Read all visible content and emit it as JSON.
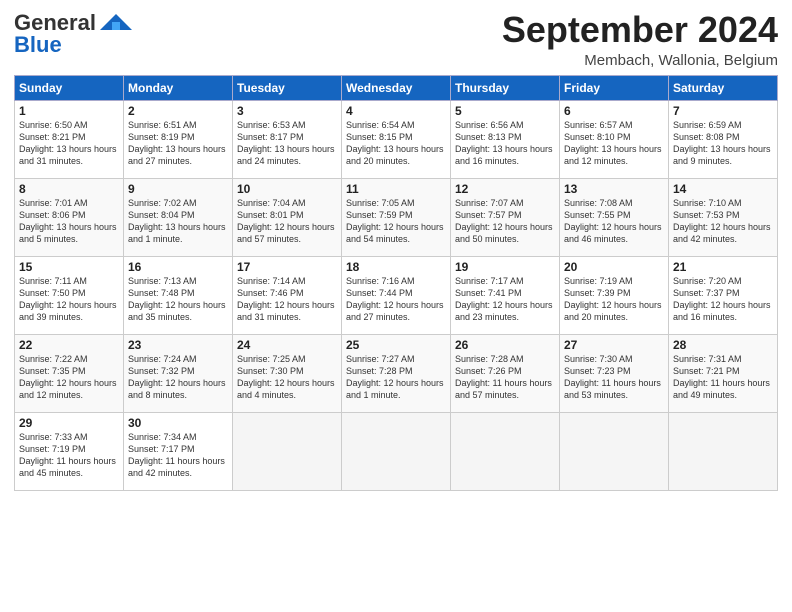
{
  "header": {
    "logo_general": "General",
    "logo_blue": "Blue",
    "month_title": "September 2024",
    "location": "Membach, Wallonia, Belgium"
  },
  "weekdays": [
    "Sunday",
    "Monday",
    "Tuesday",
    "Wednesday",
    "Thursday",
    "Friday",
    "Saturday"
  ],
  "weeks": [
    [
      {
        "day": "1",
        "sunrise": "6:50 AM",
        "sunset": "8:21 PM",
        "daylight": "13 hours and 31 minutes."
      },
      {
        "day": "2",
        "sunrise": "6:51 AM",
        "sunset": "8:19 PM",
        "daylight": "13 hours and 27 minutes."
      },
      {
        "day": "3",
        "sunrise": "6:53 AM",
        "sunset": "8:17 PM",
        "daylight": "13 hours and 24 minutes."
      },
      {
        "day": "4",
        "sunrise": "6:54 AM",
        "sunset": "8:15 PM",
        "daylight": "13 hours and 20 minutes."
      },
      {
        "day": "5",
        "sunrise": "6:56 AM",
        "sunset": "8:13 PM",
        "daylight": "13 hours and 16 minutes."
      },
      {
        "day": "6",
        "sunrise": "6:57 AM",
        "sunset": "8:10 PM",
        "daylight": "13 hours and 12 minutes."
      },
      {
        "day": "7",
        "sunrise": "6:59 AM",
        "sunset": "8:08 PM",
        "daylight": "13 hours and 9 minutes."
      }
    ],
    [
      {
        "day": "8",
        "sunrise": "7:01 AM",
        "sunset": "8:06 PM",
        "daylight": "13 hours and 5 minutes."
      },
      {
        "day": "9",
        "sunrise": "7:02 AM",
        "sunset": "8:04 PM",
        "daylight": "13 hours and 1 minute."
      },
      {
        "day": "10",
        "sunrise": "7:04 AM",
        "sunset": "8:01 PM",
        "daylight": "12 hours and 57 minutes."
      },
      {
        "day": "11",
        "sunrise": "7:05 AM",
        "sunset": "7:59 PM",
        "daylight": "12 hours and 54 minutes."
      },
      {
        "day": "12",
        "sunrise": "7:07 AM",
        "sunset": "7:57 PM",
        "daylight": "12 hours and 50 minutes."
      },
      {
        "day": "13",
        "sunrise": "7:08 AM",
        "sunset": "7:55 PM",
        "daylight": "12 hours and 46 minutes."
      },
      {
        "day": "14",
        "sunrise": "7:10 AM",
        "sunset": "7:53 PM",
        "daylight": "12 hours and 42 minutes."
      }
    ],
    [
      {
        "day": "15",
        "sunrise": "7:11 AM",
        "sunset": "7:50 PM",
        "daylight": "12 hours and 39 minutes."
      },
      {
        "day": "16",
        "sunrise": "7:13 AM",
        "sunset": "7:48 PM",
        "daylight": "12 hours and 35 minutes."
      },
      {
        "day": "17",
        "sunrise": "7:14 AM",
        "sunset": "7:46 PM",
        "daylight": "12 hours and 31 minutes."
      },
      {
        "day": "18",
        "sunrise": "7:16 AM",
        "sunset": "7:44 PM",
        "daylight": "12 hours and 27 minutes."
      },
      {
        "day": "19",
        "sunrise": "7:17 AM",
        "sunset": "7:41 PM",
        "daylight": "12 hours and 23 minutes."
      },
      {
        "day": "20",
        "sunrise": "7:19 AM",
        "sunset": "7:39 PM",
        "daylight": "12 hours and 20 minutes."
      },
      {
        "day": "21",
        "sunrise": "7:20 AM",
        "sunset": "7:37 PM",
        "daylight": "12 hours and 16 minutes."
      }
    ],
    [
      {
        "day": "22",
        "sunrise": "7:22 AM",
        "sunset": "7:35 PM",
        "daylight": "12 hours and 12 minutes."
      },
      {
        "day": "23",
        "sunrise": "7:24 AM",
        "sunset": "7:32 PM",
        "daylight": "12 hours and 8 minutes."
      },
      {
        "day": "24",
        "sunrise": "7:25 AM",
        "sunset": "7:30 PM",
        "daylight": "12 hours and 4 minutes."
      },
      {
        "day": "25",
        "sunrise": "7:27 AM",
        "sunset": "7:28 PM",
        "daylight": "12 hours and 1 minute."
      },
      {
        "day": "26",
        "sunrise": "7:28 AM",
        "sunset": "7:26 PM",
        "daylight": "11 hours and 57 minutes."
      },
      {
        "day": "27",
        "sunrise": "7:30 AM",
        "sunset": "7:23 PM",
        "daylight": "11 hours and 53 minutes."
      },
      {
        "day": "28",
        "sunrise": "7:31 AM",
        "sunset": "7:21 PM",
        "daylight": "11 hours and 49 minutes."
      }
    ],
    [
      {
        "day": "29",
        "sunrise": "7:33 AM",
        "sunset": "7:19 PM",
        "daylight": "11 hours and 45 minutes."
      },
      {
        "day": "30",
        "sunrise": "7:34 AM",
        "sunset": "7:17 PM",
        "daylight": "11 hours and 42 minutes."
      },
      null,
      null,
      null,
      null,
      null
    ]
  ]
}
